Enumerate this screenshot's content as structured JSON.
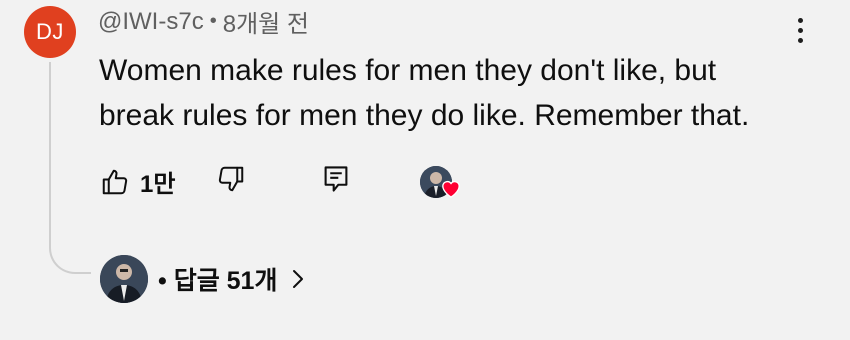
{
  "comment": {
    "avatar_initials": "DJ",
    "avatar_color": "#e0401f",
    "author": "@IWI-s7c",
    "separator": "•",
    "time": "8개월 전",
    "text_lines": [
      "Women make rules for men they don't like, but",
      "break rules for men they do like. Remember that."
    ]
  },
  "actions": {
    "like_icon": "thumbs-up-icon",
    "like_count": "1만",
    "dislike_icon": "thumbs-down-icon",
    "reply_icon": "reply-comment-icon",
    "creator_heart_icon": "heart-icon",
    "heart_color": "#ff0033"
  },
  "replies": {
    "label": "• 답글 51개",
    "chevron_icon": "chevron-right-icon"
  },
  "menu": {
    "icon": "more-vert-icon"
  }
}
